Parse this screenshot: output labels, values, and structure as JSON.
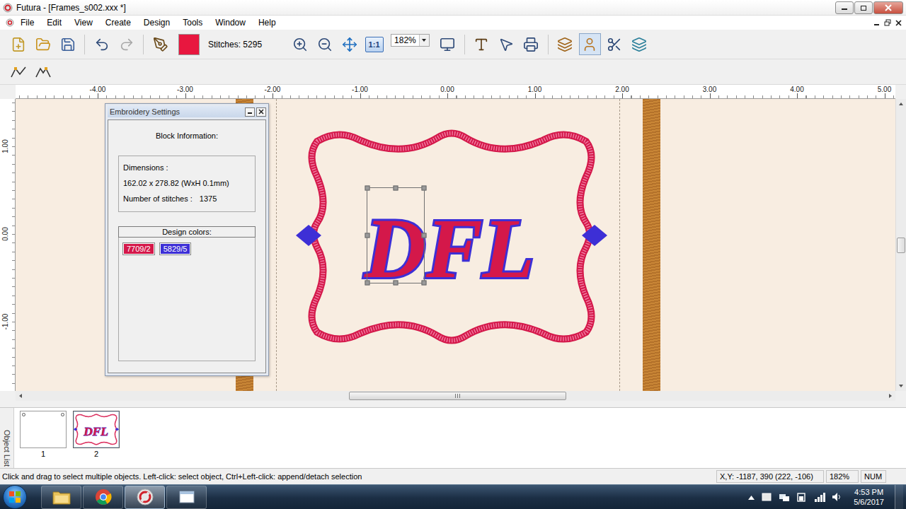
{
  "window": {
    "title": "Futura - [Frames_s002.xxx *]"
  },
  "menu": [
    "File",
    "Edit",
    "View",
    "Create",
    "Design",
    "Tools",
    "Window",
    "Help"
  ],
  "toolbar": {
    "redo_enabled": false,
    "thread_color": "#e8173f",
    "stitches": "Stitches: 5295",
    "actual_size": "1:1",
    "zoom": "182%",
    "photo_tool_pressed": true
  },
  "rulers": {
    "horizontal": [
      "-4.00",
      "-3.00",
      "-2.00",
      "-1.00",
      "0.00",
      "1.00",
      "2.00",
      "3.00",
      "4.00",
      "5.00"
    ],
    "vertical": [
      "1.00",
      "0.00",
      "-1.00"
    ]
  },
  "design": {
    "monogram": "DFL",
    "letter_selected": true
  },
  "settings_panel": {
    "title": "Embroidery Settings",
    "heading": "Block Information:",
    "dimensions_label": "Dimensions :",
    "dimensions": "162.02 x 278.82 (WxH 0.1mm)",
    "stitches_label": "Number of stitches :",
    "stitches": "1375",
    "colors_heading": "Design colors:",
    "colors": [
      {
        "label": "7709/2",
        "color": "#d4184a"
      },
      {
        "label": "5829/5",
        "color": "#3d2fd6"
      }
    ]
  },
  "object_list": {
    "label": "Object List",
    "items": [
      {
        "label": "1",
        "selected": false,
        "empty": true
      },
      {
        "label": "2",
        "selected": true,
        "empty": false
      }
    ]
  },
  "status_bar": {
    "hint": "Click and drag to select multiple objects. Left-click: select object, Ctrl+Left-click: append/detach selection",
    "coords": "X,Y: -1187, 390  (222, -106)",
    "zoom": "182%",
    "num": "NUM"
  },
  "taskbar": {
    "apps": [
      {
        "kind": "explorer",
        "selected": false
      },
      {
        "kind": "chrome",
        "selected": false
      },
      {
        "kind": "futura",
        "selected": true
      },
      {
        "kind": "window",
        "selected": false
      }
    ],
    "time": "4:53 PM",
    "date": "5/6/2017"
  }
}
